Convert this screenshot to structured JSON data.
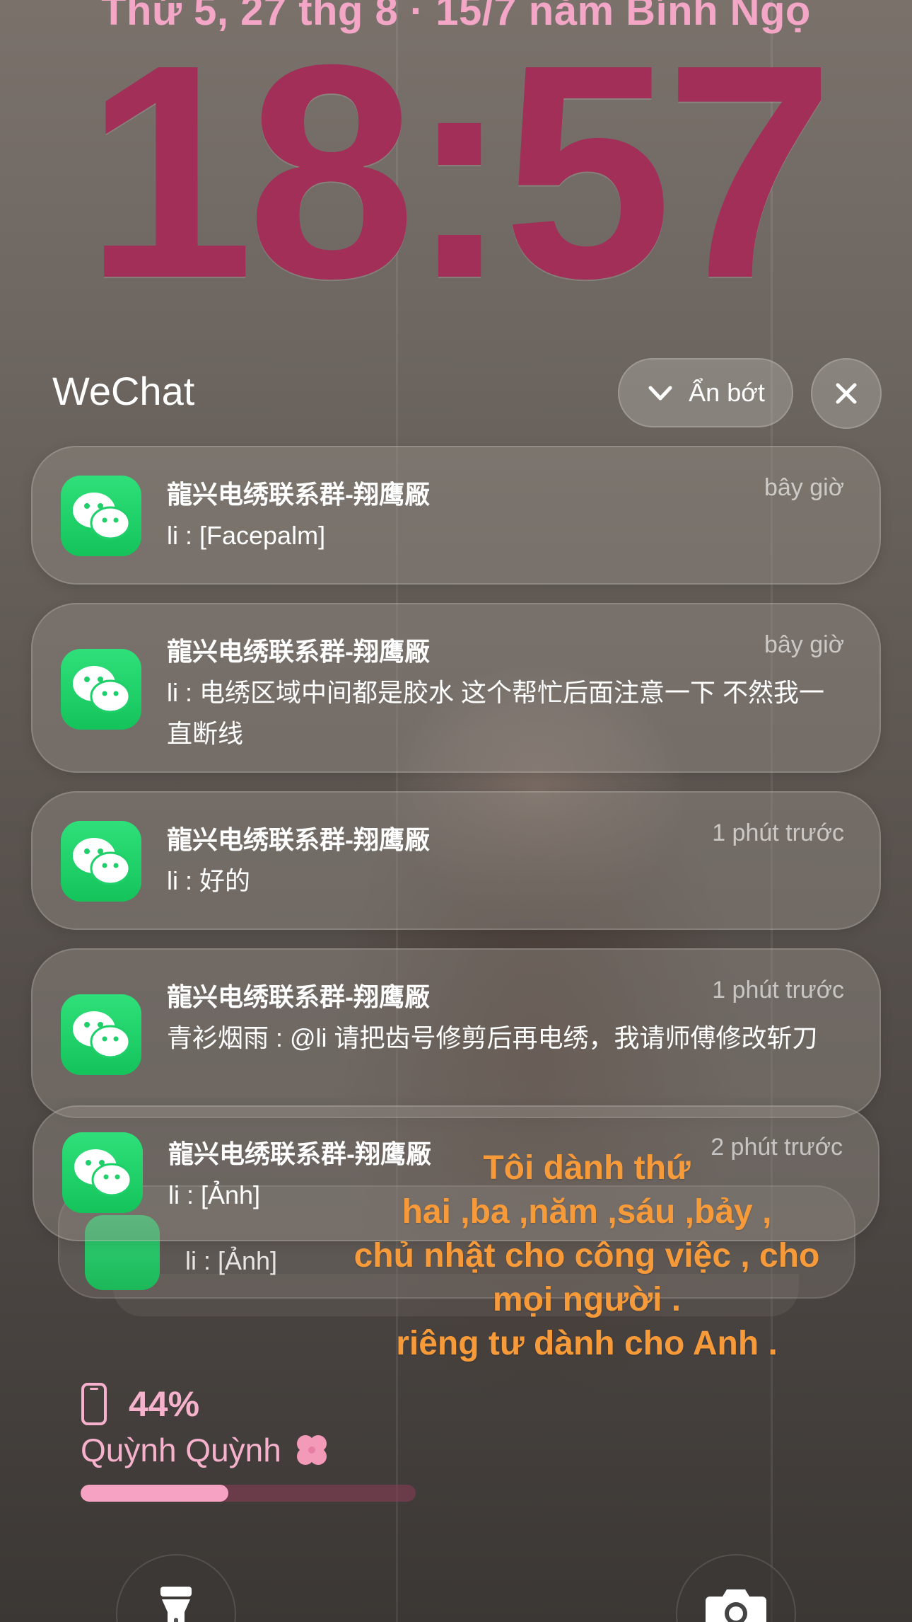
{
  "lockscreen": {
    "date": "Thứ 5, 27 thg 8 · 15/7 năm Bính Ngọ",
    "time": "18:57"
  },
  "notification_stack": {
    "app_name": "WeChat",
    "collapse_label": "Ẩn bớt",
    "items": [
      {
        "group": "龍兴电绣联系群-翔鹰厰",
        "time": "bây giờ",
        "message": "li : [Facepalm]"
      },
      {
        "group": "龍兴电绣联系群-翔鹰厰",
        "time": "bây giờ",
        "message": "li : 电绣区域中间都是胶水  这个帮忙后面注意一下  不然我一直断线"
      },
      {
        "group": "龍兴电绣联系群-翔鹰厰",
        "time": "1 phút trước",
        "message": "li : 好的"
      },
      {
        "group": "龍兴电绣联系群-翔鹰厰",
        "time": "1 phút trước",
        "message": "青衫烟雨 : @li 请把齿号修剪后再电绣，我请师傅修改斩刀"
      },
      {
        "group": "龍兴电绣联系群-翔鹰厰",
        "time": "2 phút trước",
        "message": "li : [Ảnh]"
      }
    ],
    "stacked_preview": "li : [Ảnh]"
  },
  "overlay_caption": [
    "Tôi dành thứ",
    "hai ,ba ,năm ,sáu ,bảy ,",
    "chủ nhật cho công việc , cho",
    "mọi người .",
    "riêng tư dành cho Anh ."
  ],
  "battery_widget": {
    "percent_label": "44%",
    "percent": 0.44,
    "device_name": "Quỳnh Quỳnh"
  },
  "icons": {
    "app": "wechat-icon",
    "collapse": "chevron-down-icon",
    "close": "close-icon",
    "battery": "phone-battery-icon",
    "decor": "four-leaf-clover-icon",
    "flashlight": "flashlight-icon",
    "camera": "camera-icon"
  },
  "colors": {
    "clock": "#a12f57",
    "date": "#f4a6c6",
    "caption": "#f79a3a",
    "widget": "#f6b1cc",
    "wechat_green": "#1fd06a"
  }
}
